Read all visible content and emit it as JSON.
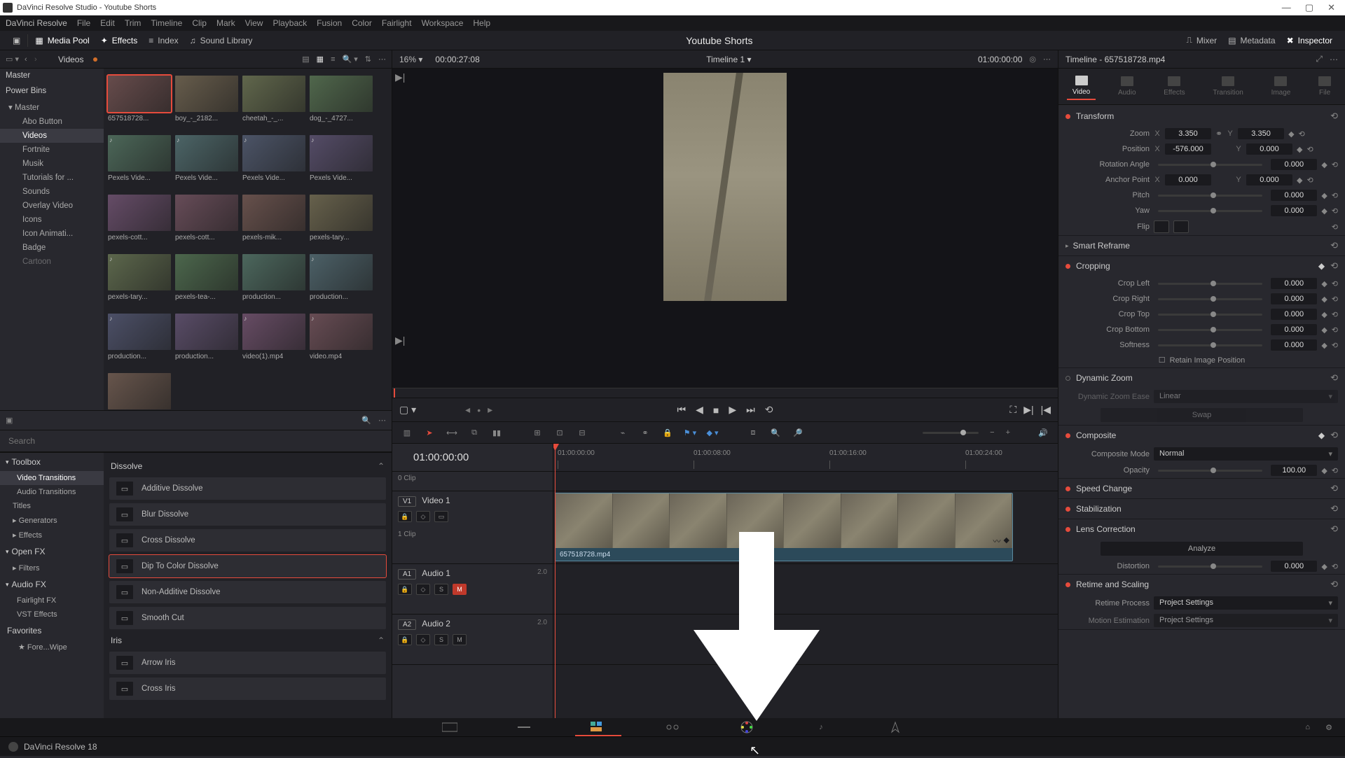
{
  "window_title": "DaVinci Resolve Studio - Youtube Shorts",
  "app_menu": [
    "DaVinci Resolve",
    "File",
    "Edit",
    "Trim",
    "Timeline",
    "Clip",
    "Mark",
    "View",
    "Playback",
    "Fusion",
    "Color",
    "Fairlight",
    "Workspace",
    "Help"
  ],
  "toolbar": {
    "media_pool": "Media Pool",
    "effects": "Effects",
    "index": "Index",
    "sound_library": "Sound Library",
    "mixer": "Mixer",
    "metadata": "Metadata",
    "inspector": "Inspector"
  },
  "project_title": "Youtube Shorts",
  "media": {
    "current_bin": "Videos",
    "tree": {
      "master": "Master",
      "power_bins": "Power Bins",
      "pb_master": "Master",
      "items": [
        "Abo Button",
        "Videos",
        "Fortnite",
        "Musik",
        "Tutorials for ...",
        "Sounds",
        "Overlay Video",
        "Icons",
        "Icon Animati...",
        "Badge",
        "Cartoon"
      ]
    },
    "clips": [
      {
        "name": "657518728...",
        "sel": true
      },
      {
        "name": "boy_-_2182..."
      },
      {
        "name": "cheetah_-_..."
      },
      {
        "name": "dog_-_4727..."
      },
      {
        "name": "Pexels Vide...",
        "audio": true
      },
      {
        "name": "Pexels Vide...",
        "audio": true
      },
      {
        "name": "Pexels Vide...",
        "audio": true
      },
      {
        "name": "Pexels Vide...",
        "audio": true
      },
      {
        "name": "pexels-cott..."
      },
      {
        "name": "pexels-cott..."
      },
      {
        "name": "pexels-mik..."
      },
      {
        "name": "pexels-tary..."
      },
      {
        "name": "pexels-tary...",
        "audio": true
      },
      {
        "name": "pexels-tea-..."
      },
      {
        "name": "production..."
      },
      {
        "name": "production...",
        "audio": true
      },
      {
        "name": "production...",
        "audio": true
      },
      {
        "name": "production..."
      },
      {
        "name": "video(1).mp4",
        "audio": true
      },
      {
        "name": "video.mp4",
        "audio": true
      },
      {
        "name": ""
      }
    ]
  },
  "fx": {
    "search_placeholder": "Search",
    "toolbox": "Toolbox",
    "tree": [
      "Video Transitions",
      "Audio Transitions",
      "Titles",
      "Generators",
      "Effects"
    ],
    "openfx": "Open FX",
    "openfx_items": [
      "Filters"
    ],
    "audiofx": "Audio FX",
    "audiofx_items": [
      "Fairlight FX",
      "VST Effects"
    ],
    "favorites": "Favorites",
    "fav_items": [
      "Fore...Wipe"
    ],
    "groups": [
      {
        "title": "Dissolve",
        "items": [
          "Additive Dissolve",
          "Blur Dissolve",
          "Cross Dissolve",
          "Dip To Color Dissolve",
          "Non-Additive Dissolve",
          "Smooth Cut"
        ],
        "selected": 3
      },
      {
        "title": "Iris",
        "items": [
          "Arrow Iris",
          "Cross Iris"
        ]
      }
    ]
  },
  "viewer": {
    "zoom": "16%",
    "src_tc": "00:00:27:08",
    "timeline_name": "Timeline 1",
    "rec_tc": "01:00:00:00"
  },
  "timeline": {
    "current_tc": "01:00:00:00",
    "ticks": [
      "01:00:00:00",
      "01:00:08:00",
      "01:00:16:00",
      "01:00:24:00"
    ],
    "empty_track_label": "0 Clip",
    "v1": {
      "tag": "V1",
      "name": "Video 1",
      "count": "1 Clip",
      "clip": "657518728.mp4"
    },
    "a1": {
      "tag": "A1",
      "name": "Audio 1",
      "meter": "2.0"
    },
    "a2": {
      "tag": "A2",
      "name": "Audio 2",
      "meter": "2.0"
    },
    "track_buttons": {
      "lock": "",
      "auto": "",
      "solo": "S",
      "mute": "M"
    }
  },
  "inspector": {
    "title": "Timeline - 657518728.mp4",
    "tabs": [
      "Video",
      "Audio",
      "Effects",
      "Transition",
      "Image",
      "File"
    ],
    "transform": {
      "title": "Transform",
      "zoom_label": "Zoom",
      "zoom_x": "3.350",
      "zoom_y": "3.350",
      "pos_label": "Position",
      "pos_x": "-576.000",
      "pos_y": "0.000",
      "rot_label": "Rotation Angle",
      "rot": "0.000",
      "anchor_label": "Anchor Point",
      "anchor_x": "0.000",
      "anchor_y": "0.000",
      "pitch_label": "Pitch",
      "pitch": "0.000",
      "yaw_label": "Yaw",
      "yaw": "0.000",
      "flip_label": "Flip"
    },
    "smart_reframe": "Smart Reframe",
    "cropping": {
      "title": "Cropping",
      "left_label": "Crop Left",
      "left": "0.000",
      "right_label": "Crop Right",
      "right": "0.000",
      "top_label": "Crop Top",
      "top": "0.000",
      "bottom_label": "Crop Bottom",
      "bottom": "0.000",
      "soft_label": "Softness",
      "soft": "0.000",
      "retain": "Retain Image Position"
    },
    "dynamic_zoom": {
      "title": "Dynamic Zoom",
      "ease_label": "Dynamic Zoom Ease",
      "ease": "Linear",
      "swap": "Swap"
    },
    "composite": {
      "title": "Composite",
      "mode_label": "Composite Mode",
      "mode": "Normal",
      "opacity_label": "Opacity",
      "opacity": "100.00"
    },
    "speed": "Speed Change",
    "stab": "Stabilization",
    "lens": {
      "title": "Lens Correction",
      "analyze": "Analyze",
      "dist_label": "Distortion",
      "dist": "0.000"
    },
    "retime": {
      "title": "Retime and Scaling",
      "proc_label": "Retime Process",
      "proc": "Project Settings",
      "motion_label": "Motion Estimation",
      "motion": "Project Settings"
    }
  },
  "status": "DaVinci Resolve 18",
  "axis": {
    "x": "X",
    "y": "Y"
  }
}
